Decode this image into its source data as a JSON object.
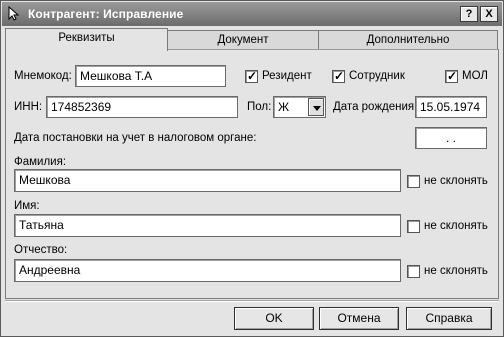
{
  "window": {
    "title": "Контрагент: Исправление",
    "help_button": "?",
    "close_button": "X"
  },
  "tabs": [
    {
      "label": "Реквизиты",
      "active": true
    },
    {
      "label": "Документ",
      "active": false
    },
    {
      "label": "Дополнительно",
      "active": false
    }
  ],
  "form": {
    "mnemocode_label": "Мнемокод:",
    "mnemocode_value": "Мешкова Т.А",
    "resident_label": "Резидент",
    "resident_checked": true,
    "employee_label": "Сотрудник",
    "employee_checked": true,
    "mol_label": "МОЛ",
    "mol_checked": true,
    "inn_label": "ИНН:",
    "inn_value": "174852369",
    "gender_label": "Пол:",
    "gender_value": "Ж",
    "birthdate_label": "Дата рождения:",
    "birthdate_value": "15.05.1974",
    "tax_reg_date_label": "Дата постановки на учет в налоговом органе:",
    "tax_reg_date_value": ". .",
    "surname_label": "Фамилия:",
    "surname_value": "Мешкова",
    "name_label": "Имя:",
    "name_value": "Татьяна",
    "patronymic_label": "Отчество:",
    "patronymic_value": "Андреевна",
    "no_decline_label": "не склонять",
    "checkmark": "✓"
  },
  "buttons": {
    "ok": "OK",
    "cancel": "Отмена",
    "help": "Справка"
  }
}
